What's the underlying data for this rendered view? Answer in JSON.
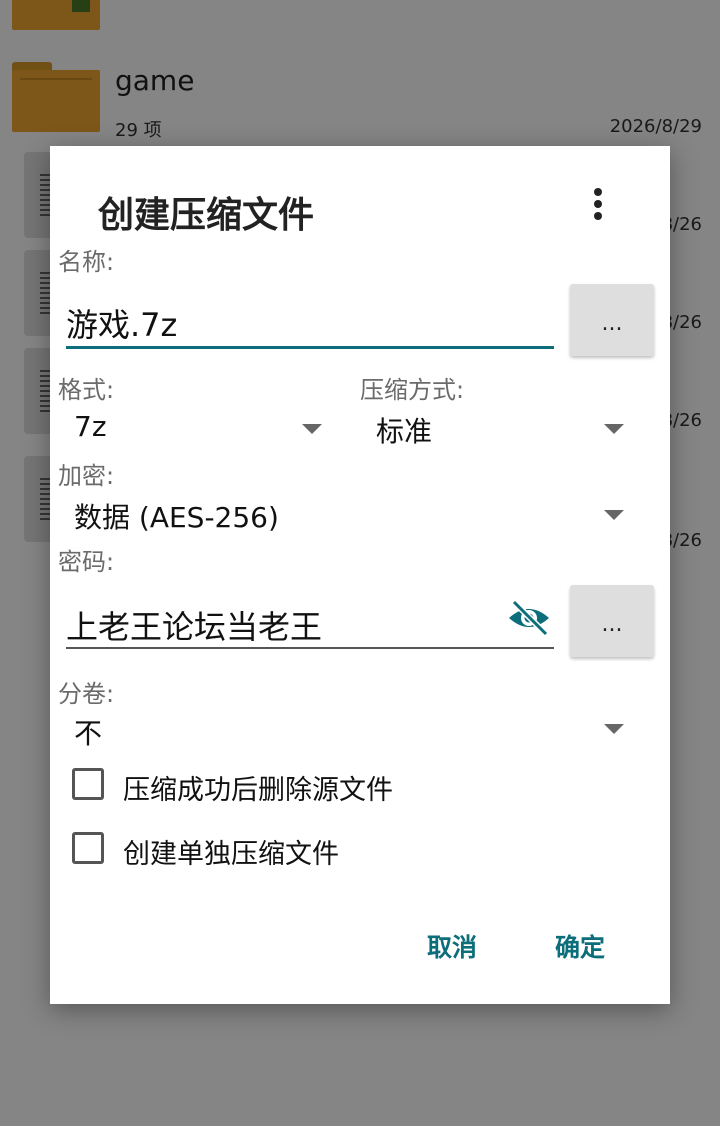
{
  "background": {
    "folder": {
      "name": "game",
      "count": "29 项",
      "date": "2026/8/29"
    },
    "dates": [
      "8/26",
      "8/26",
      "8/26",
      "8/26"
    ]
  },
  "dialog": {
    "title": "创建压缩文件",
    "more_icon": "more-vert-icon",
    "name_label": "名称:",
    "name_value": "游戏.7z",
    "browse_label": "...",
    "format_label": "格式:",
    "format_value": "7z",
    "method_label": "压缩方式:",
    "method_value": "标准",
    "encrypt_label": "加密:",
    "encrypt_value": "数据 (AES-256)",
    "password_label": "密码:",
    "password_value": "上老王论坛当老王",
    "password_browse_label": "...",
    "visibility_icon": "eye-off-icon",
    "split_label": "分卷:",
    "split_value": "不",
    "delete_source_label": "压缩成功后删除源文件",
    "delete_source_checked": false,
    "separate_archives_label": "创建单独压缩文件",
    "separate_archives_checked": false,
    "cancel_label": "取消",
    "ok_label": "确定"
  },
  "colors": {
    "accent": "#0b6e7a",
    "folder": "#f0a830",
    "scrim": "rgba(0,0,0,0.48)"
  }
}
